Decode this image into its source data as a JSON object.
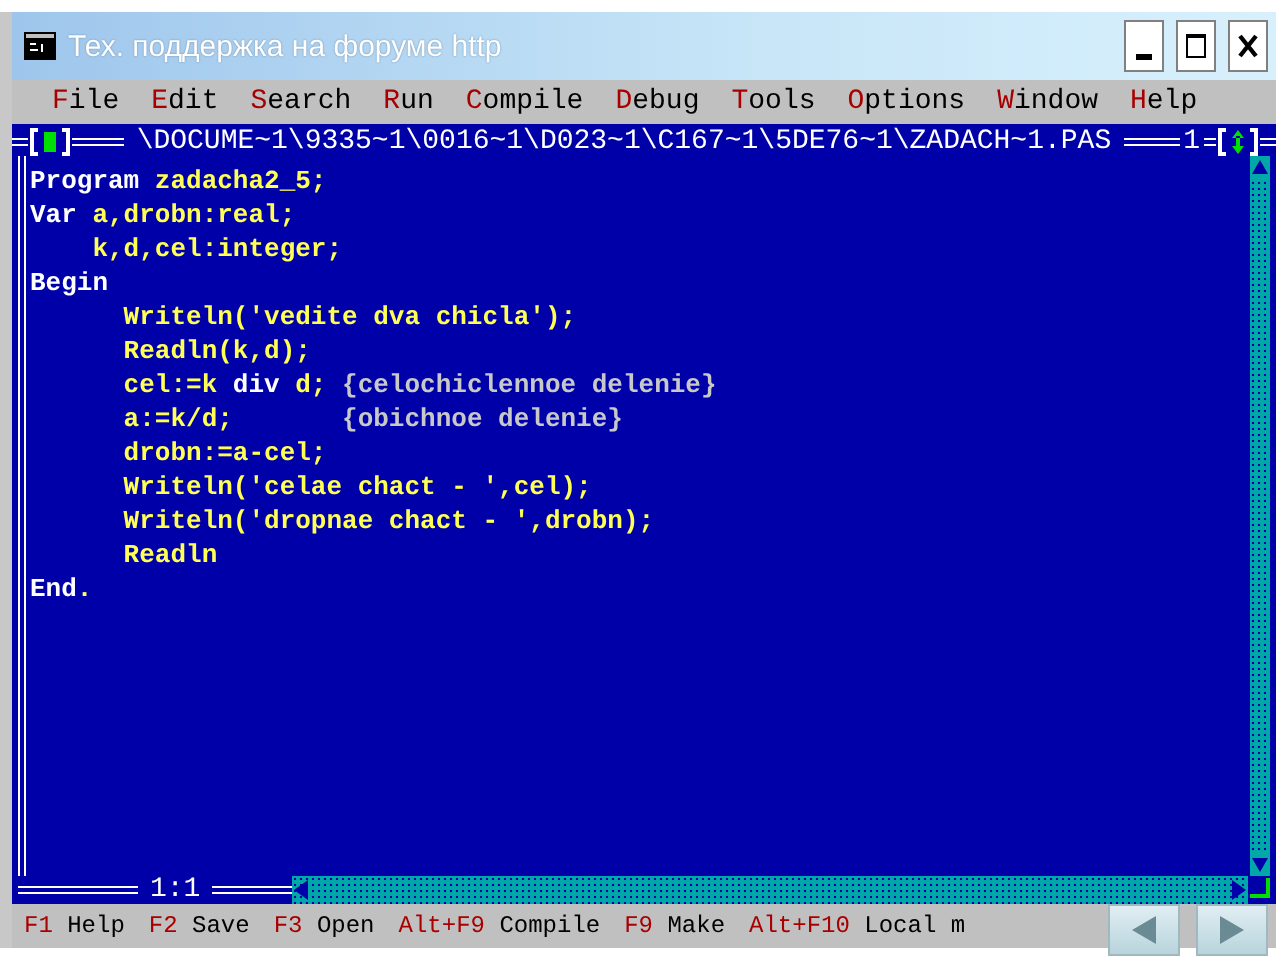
{
  "window": {
    "title": "Тех. поддержка на форуме http"
  },
  "menu": [
    {
      "hotkey": "F",
      "rest": "ile"
    },
    {
      "hotkey": "E",
      "rest": "dit"
    },
    {
      "hotkey": "S",
      "rest": "earch"
    },
    {
      "hotkey": "R",
      "rest": "un"
    },
    {
      "hotkey": "C",
      "rest": "ompile"
    },
    {
      "hotkey": "D",
      "rest": "ebug"
    },
    {
      "hotkey": "T",
      "rest": "ools"
    },
    {
      "hotkey": "O",
      "rest": "ptions"
    },
    {
      "hotkey": "W",
      "rest": "indow"
    },
    {
      "hotkey": "H",
      "rest": "elp"
    }
  ],
  "editor": {
    "file_path": "\\DOCUME~1\\9335~1\\0016~1\\D023~1\\C167~1\\5DE76~1\\ZADACH~1.PAS",
    "window_number": "1",
    "cursor_position": "1:1",
    "lines": [
      [
        {
          "kind": "keyword",
          "text": "Program"
        },
        {
          "kind": "text",
          "text": " zadacha2_5;"
        }
      ],
      [
        {
          "kind": "keyword",
          "text": "Var"
        },
        {
          "kind": "text",
          "text": " a,drobn:real;"
        }
      ],
      [
        {
          "kind": "text",
          "text": "    k,d,cel:integer;"
        }
      ],
      [
        {
          "kind": "keyword",
          "text": "Begin"
        }
      ],
      [
        {
          "kind": "text",
          "text": "      Writeln('vedite dva chicla');"
        }
      ],
      [
        {
          "kind": "text",
          "text": "      Readln(k,d);"
        }
      ],
      [
        {
          "kind": "text",
          "text": "      cel:=k "
        },
        {
          "kind": "keyword",
          "text": "div"
        },
        {
          "kind": "text",
          "text": " d; "
        },
        {
          "kind": "comment",
          "text": "{celochiclennoe delenie}"
        }
      ],
      [
        {
          "kind": "text",
          "text": "      a:=k/d;       "
        },
        {
          "kind": "comment",
          "text": "{obichnoe delenie}"
        }
      ],
      [
        {
          "kind": "text",
          "text": "      drobn:=a-cel;"
        }
      ],
      [
        {
          "kind": "text",
          "text": "      Writeln('celae chact - ',cel);"
        }
      ],
      [
        {
          "kind": "text",
          "text": "      Writeln('dropnae chact - ',drobn);"
        }
      ],
      [
        {
          "kind": "text",
          "text": "      Readln"
        }
      ],
      [
        {
          "kind": "keyword",
          "text": "End"
        },
        {
          "kind": "text",
          "text": "."
        }
      ]
    ]
  },
  "status_bar": [
    {
      "key": "F1",
      "label": "Help"
    },
    {
      "key": "F2",
      "label": "Save"
    },
    {
      "key": "F3",
      "label": "Open"
    },
    {
      "key": "Alt+F9",
      "label": "Compile"
    },
    {
      "key": "F9",
      "label": "Make"
    },
    {
      "key": "Alt+F10",
      "label": "Local m"
    }
  ]
}
